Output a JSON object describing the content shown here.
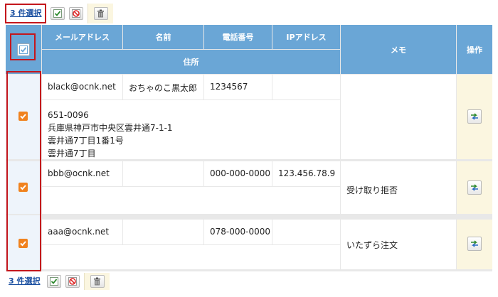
{
  "selection": {
    "count_label": "3 件選択"
  },
  "headers": {
    "email": "メールアドレス",
    "name": "名前",
    "phone": "電話番号",
    "ip": "IPアドレス",
    "memo": "メモ",
    "actions": "操作",
    "address": "住所"
  },
  "rows": [
    {
      "email": "black@ocnk.net",
      "name": "おちゃのこ黒太郎",
      "phone": "1234567",
      "ip": "",
      "address": "651-0096\n兵庫県神戸市中央区雲井通7-1-1\n雲井通7丁目1番1号\n雲井通7丁目",
      "memo": "",
      "checked": true
    },
    {
      "email": "bbb@ocnk.net",
      "name": "",
      "phone": "000-000-0000",
      "ip": "123.456.78.9",
      "address": "",
      "memo": "受け取り拒否",
      "checked": true
    },
    {
      "email": "aaa@ocnk.net",
      "name": "",
      "phone": "078-000-0000",
      "ip": "",
      "address": "",
      "memo": "いたずら注文",
      "checked": true
    }
  ],
  "colors": {
    "header": "#6aa6d6",
    "checkbox": "#f0821e",
    "highlight": "#c4161c",
    "action_col": "#fbf6e0"
  },
  "icons": {
    "check_all": "check-all-icon",
    "uncheck_all": "uncheck-all-icon",
    "delete": "trash-icon",
    "edit": "edit-arrows-icon"
  }
}
